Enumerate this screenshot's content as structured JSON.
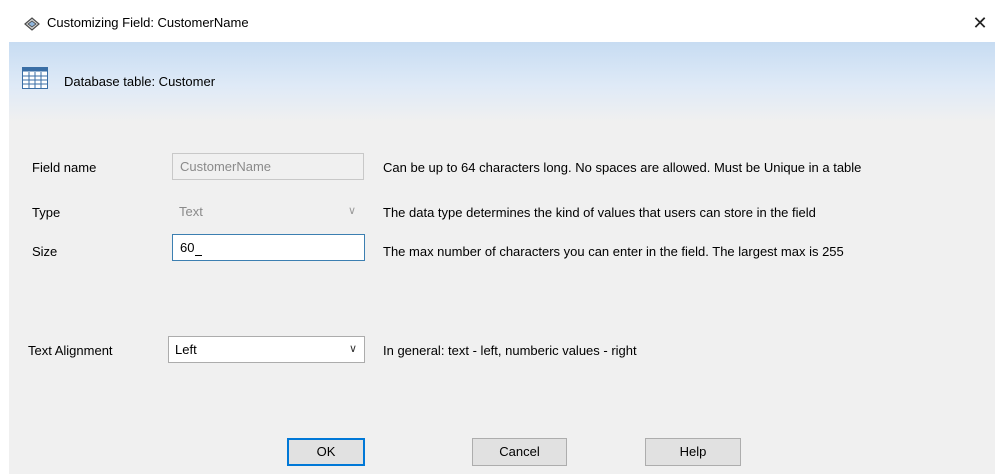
{
  "window": {
    "title": "Customizing Field: CustomerName",
    "close_glyph": "✕"
  },
  "header": {
    "text": "Database table: Customer"
  },
  "fields": {
    "field_name": {
      "label": "Field name",
      "value": "CustomerName",
      "description": "Can be up to 64 characters long. No spaces are allowed. Must be Unique in a table"
    },
    "type": {
      "label": "Type",
      "value": "Text",
      "description": "The data type determines the kind of values that users can store in the field"
    },
    "size": {
      "label": "Size",
      "value": "60",
      "description": "The max number of characters you can enter in the field.  The largest max is 255"
    },
    "text_alignment": {
      "label": "Text Alignment",
      "value": "Left",
      "description": "In general: text - left, numberic values - right"
    }
  },
  "buttons": {
    "ok": "OK",
    "cancel": "Cancel",
    "help": "Help"
  },
  "icons": {
    "title": "app-dialog-icon",
    "header": "database-table-icon",
    "dropdown": "chevron-down-icon"
  },
  "colors": {
    "header_gradient_top": "#c7dcf2",
    "dialog_background": "#f0f0f0",
    "focus_border": "#3c7fb1",
    "default_button_border": "#0078d7"
  }
}
